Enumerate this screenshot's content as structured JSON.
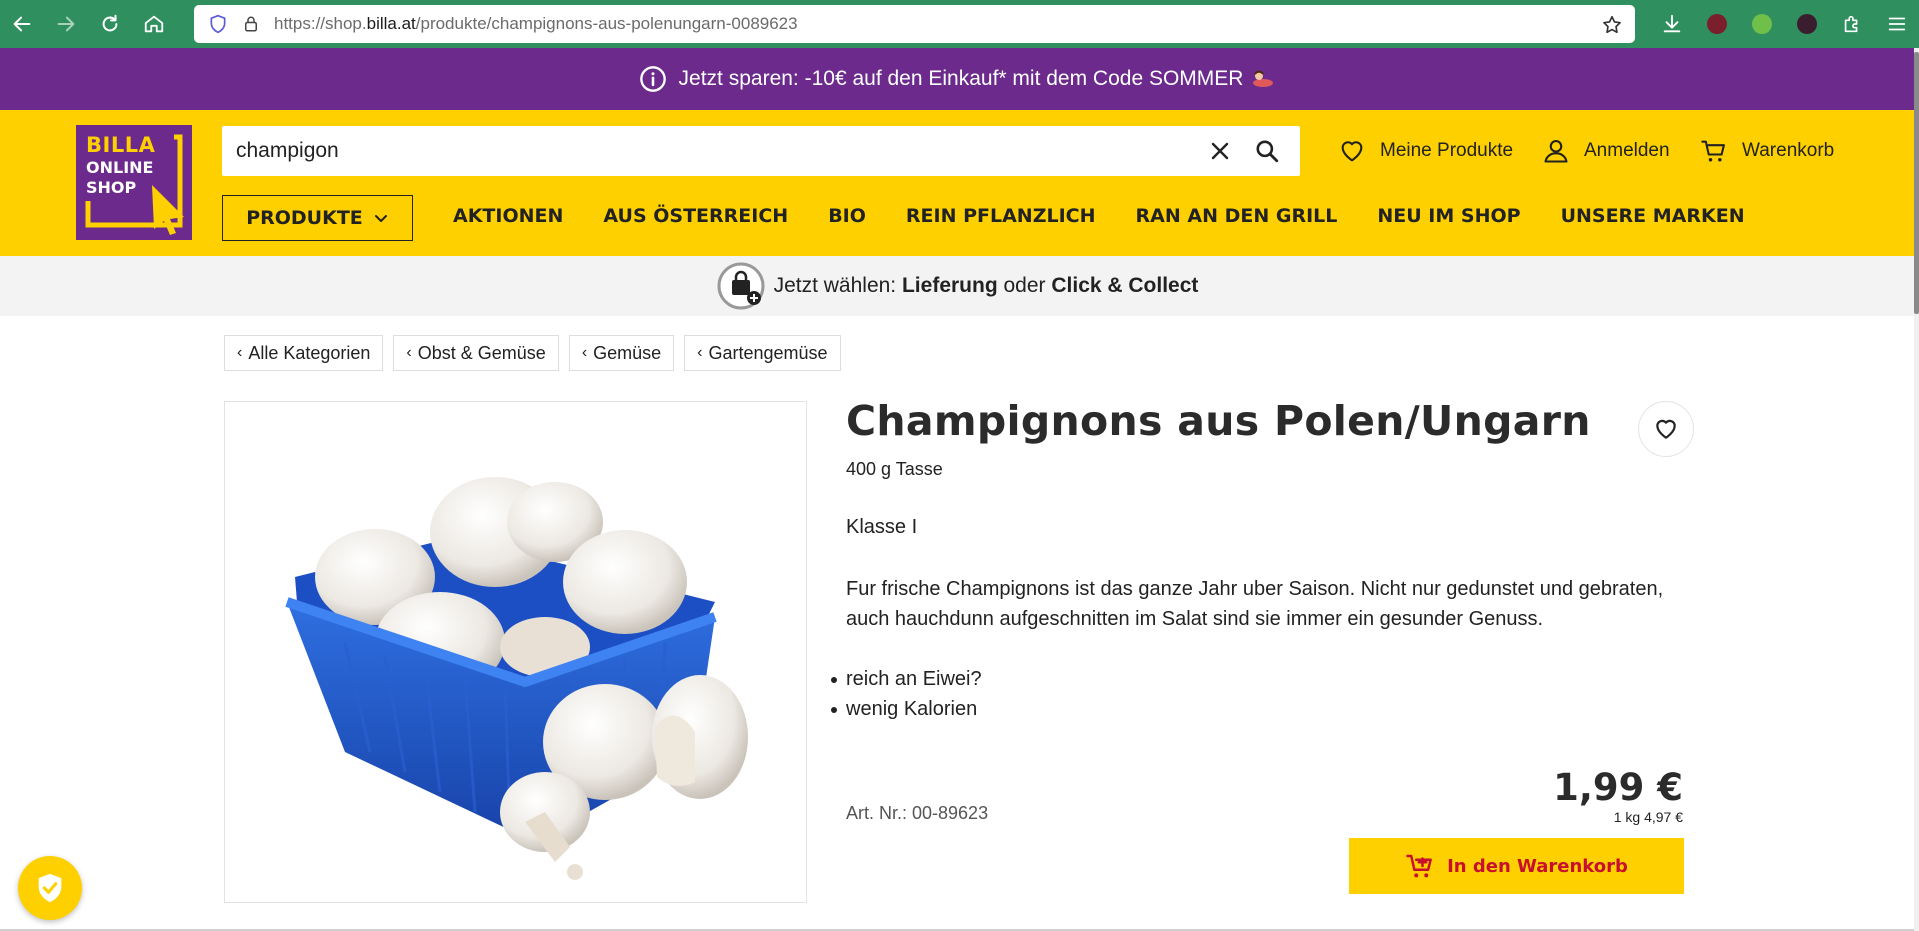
{
  "browser": {
    "url_prefix": "https://shop.",
    "url_domain": "billa.at",
    "url_path": "/produkte/champignons-aus-polenungarn-0089623"
  },
  "promo": {
    "text": "Jetzt sparen: -10€ auf den Einkauf* mit dem Code SOMMER"
  },
  "logo": {
    "line1": "BILLA",
    "line2": "ONLINE",
    "line3": "SHOP"
  },
  "search": {
    "value": "champigon"
  },
  "header_links": {
    "favorites": "Meine Produkte",
    "login": "Anmelden",
    "cart": "Warenkorb"
  },
  "nav": {
    "produkte": "PRODUKTE",
    "items": [
      "AKTIONEN",
      "AUS ÖSTERREICH",
      "BIO",
      "REIN PFLANZLICH",
      "RAN AN DEN GRILL",
      "NEU IM SHOP",
      "UNSERE MARKEN"
    ]
  },
  "delivery": {
    "prefix": "Jetzt wählen: ",
    "option1": "Lieferung",
    "middle": " oder ",
    "option2": "Click & Collect"
  },
  "breadcrumbs": [
    "Alle Kategorien",
    "Obst & Gemüse",
    "Gemüse",
    "Gartengemüse"
  ],
  "product": {
    "title": "Champignons aus Polen/Ungarn",
    "size": "400 g Tasse",
    "class": "Klasse I",
    "description": "Fur frische Champignons ist das ganze Jahr uber Saison. Nicht nur gedunstet und gebraten, auch hauchdunn aufgeschnitten im Salat sind sie immer ein gesunder Genuss.",
    "bullets": [
      "reich an Eiwei?",
      "wenig Kalorien"
    ],
    "article_no": "Art. Nr.: 00-89623",
    "price": "1,99 €",
    "unit_price": "1 kg 4,97 €",
    "add_to_cart": "In den Warenkorb"
  },
  "colors": {
    "brand_yellow": "#fed000",
    "brand_purple": "#6b2a8c",
    "cart_text_red": "#c8102e",
    "browser_toolbar": "#2f8f5e"
  }
}
